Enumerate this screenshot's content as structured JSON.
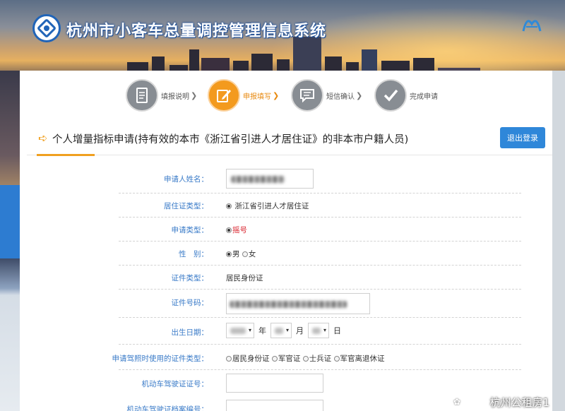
{
  "header": {
    "system_title": "杭州市小客车总量调控管理信息系统"
  },
  "steps": [
    {
      "label": "填报说明",
      "state": "done"
    },
    {
      "label": "申报填写",
      "state": "active"
    },
    {
      "label": "短信确认",
      "state": "pending"
    },
    {
      "label": "完成申请",
      "state": "pending"
    }
  ],
  "step_arrow": "❯",
  "form": {
    "title_arrow": "➪",
    "title": "个人增量指标申请(持有效的本市《浙江省引进人才居住证》的非本市户籍人员)",
    "logout_label": "退出登录",
    "fields": {
      "name": {
        "label": "申请人姓名："
      },
      "residence_type": {
        "label": "居住证类型：",
        "value": "浙江省引进人才居住证"
      },
      "apply_type": {
        "label": "申请类型：",
        "value": "摇号"
      },
      "gender": {
        "label": "性　别：",
        "options": [
          "男",
          "女"
        ],
        "selected": "男"
      },
      "id_type": {
        "label": "证件类型：",
        "value": "居民身份证"
      },
      "id_number": {
        "label": "证件号码："
      },
      "birth_date": {
        "label": "出生日期：",
        "year_unit": "年",
        "month_unit": "月",
        "day_unit": "日",
        "dropdown_glyph": "▾"
      },
      "license_cert_type": {
        "label": "申请驾照时使用的证件类型：",
        "options": [
          "居民身份证",
          "军官证",
          "士兵证",
          "军官离退休证"
        ]
      },
      "license_number": {
        "label": "机动车驾驶证证号："
      },
      "license_file_number": {
        "label": "机动车驾驶证档案编号："
      }
    }
  },
  "watermark": {
    "icon": "✿",
    "text": "杭州公租房1"
  },
  "colors": {
    "accent_orange": "#f39a1e",
    "label_blue": "#3a7bc8",
    "button_blue": "#2f87d9",
    "required_red": "#d9232d"
  }
}
